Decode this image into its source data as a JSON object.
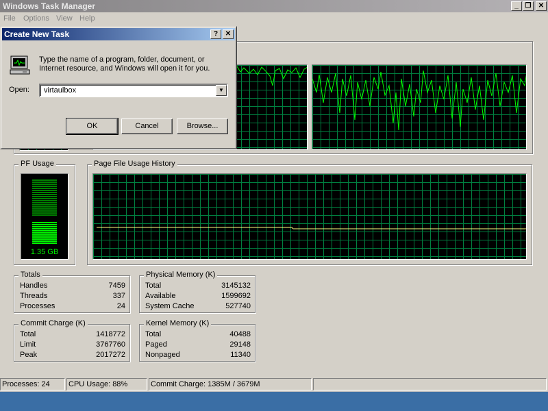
{
  "window": {
    "title": "Windows Task Manager"
  },
  "menu": [
    "File",
    "Options",
    "View",
    "Help"
  ],
  "performance": {
    "pf_usage": {
      "label": "PF Usage",
      "value": "1.35 GB",
      "fill_fraction": 0.42
    },
    "pf_history": {
      "label": "Page File Usage History"
    },
    "totals": {
      "label": "Totals",
      "rows": [
        {
          "k": "Handles",
          "v": "7459"
        },
        {
          "k": "Threads",
          "v": "337"
        },
        {
          "k": "Processes",
          "v": "24"
        }
      ]
    },
    "physical_memory": {
      "label": "Physical Memory (K)",
      "rows": [
        {
          "k": "Total",
          "v": "3145132"
        },
        {
          "k": "Available",
          "v": "1599692"
        },
        {
          "k": "System Cache",
          "v": "527740"
        }
      ]
    },
    "commit_charge": {
      "label": "Commit Charge (K)",
      "rows": [
        {
          "k": "Total",
          "v": "1418772"
        },
        {
          "k": "Limit",
          "v": "3767760"
        },
        {
          "k": "Peak",
          "v": "2017272"
        }
      ]
    },
    "kernel_memory": {
      "label": "Kernel Memory (K)",
      "rows": [
        {
          "k": "Total",
          "v": "40488"
        },
        {
          "k": "Paged",
          "v": "29148"
        },
        {
          "k": "Nonpaged",
          "v": "11340"
        }
      ]
    }
  },
  "statusbar": {
    "processes": "Processes: 24",
    "cpu": "CPU Usage: 88%",
    "commit": "Commit Charge: 1385M / 3679M"
  },
  "dialog": {
    "title": "Create New Task",
    "help_btn": "?",
    "close_btn": "✕",
    "description": "Type the name of a program, folder, document, or Internet resource, and Windows will open it for you.",
    "open_label": "Open:",
    "open_value": "virtaulbox",
    "ok": "OK",
    "cancel": "Cancel",
    "browse": "Browse..."
  },
  "colors": {
    "graph_line": "#00ff00",
    "grid": "#008040",
    "dialog_title": "#0a246a"
  }
}
